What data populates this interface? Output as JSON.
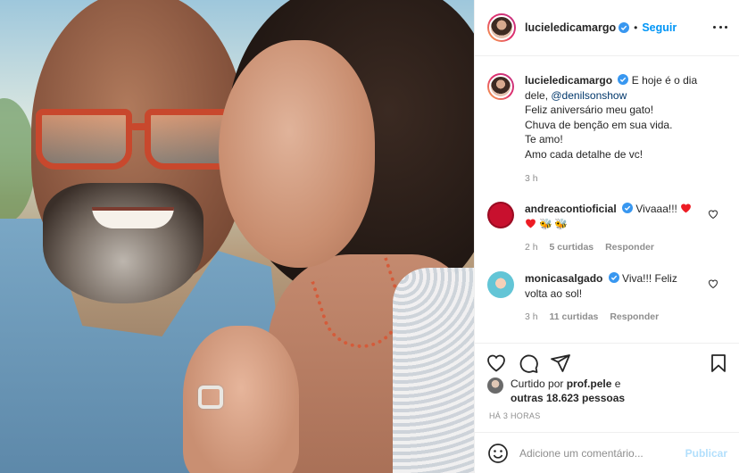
{
  "post": {
    "author": "lucieledicamargo",
    "follow_label": "Seguir",
    "dot": "•",
    "caption_lines": [
      "E hoje é o dia",
      "dele,",
      "Feliz aniversário meu gato!",
      "Chuva de benção em sua vida.",
      "Te amo!",
      "Amo cada detalhe de vc!"
    ],
    "mention": "@denilsonshow",
    "caption_time": "3 h"
  },
  "comments": [
    {
      "user": "andreacontioficial",
      "text": "Vivaaa!!!",
      "line2": "🐝🐝",
      "time": "2 h",
      "likes": "5 curtidas",
      "reply": "Responder"
    },
    {
      "user": "monicasalgado",
      "text": "Viva!!! Feliz",
      "line2": "volta ao sol!",
      "time": "3 h",
      "likes": "11 curtidas",
      "reply": "Responder"
    }
  ],
  "likes": {
    "prefix": "Curtido por",
    "user": "prof.pele",
    "mid": "e",
    "others": "outras 18.623 pessoas"
  },
  "timestamp": "HÁ 3 HORAS",
  "add_comment": {
    "placeholder": "Adicione um comentário...",
    "publish_label": "Publicar"
  },
  "icons": [
    "verified-icon",
    "more-icon",
    "heart-icon",
    "comment-icon",
    "share-icon",
    "bookmark-icon",
    "emoji-icon"
  ],
  "colors": {
    "link": "#0095f6",
    "verified": "#3897f0",
    "like": "#ed4956",
    "muted": "#8e8e8e"
  }
}
